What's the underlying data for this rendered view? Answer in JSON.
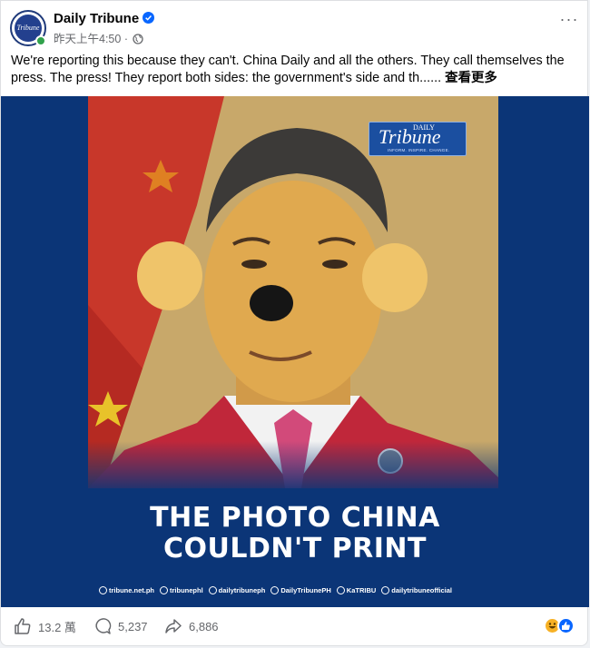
{
  "post": {
    "page_name": "Daily Tribune",
    "timestamp": "昨天上午4:50",
    "separator": " · ",
    "text": "We're reporting this because they can't. China Daily and all the others. They call themselves the press. The press! They report both sides: the government's side and th......",
    "see_more": "查看更多",
    "avatar_text": "Tribune"
  },
  "image": {
    "logo_main": "Tribune",
    "logo_small": "DAILY",
    "logo_tagline": "INFORM. INSPIRE. CHANGE.",
    "headline_line1": "THE PHOTO CHINA",
    "headline_line2": "COULDN'T PRINT",
    "socials": [
      {
        "icon": "globe-icon",
        "label": "tribune.net.ph"
      },
      {
        "icon": "facebook-x-icon",
        "label": "tribunephl"
      },
      {
        "icon": "instagram-icon",
        "label": "dailytribuneph"
      },
      {
        "icon": "youtube-icon",
        "label": "DailyTribunePH"
      },
      {
        "icon": "viber-icon",
        "label": "KaTRIBU"
      },
      {
        "icon": "tiktok-icon",
        "label": "dailytribuneofficial"
      }
    ]
  },
  "actions": {
    "likes": "13.2 萬",
    "comments": "5,237",
    "shares": "6,886"
  },
  "colors": {
    "brand_blue": "#0b3577",
    "verified_blue": "#0866ff",
    "muted": "#65676b"
  }
}
